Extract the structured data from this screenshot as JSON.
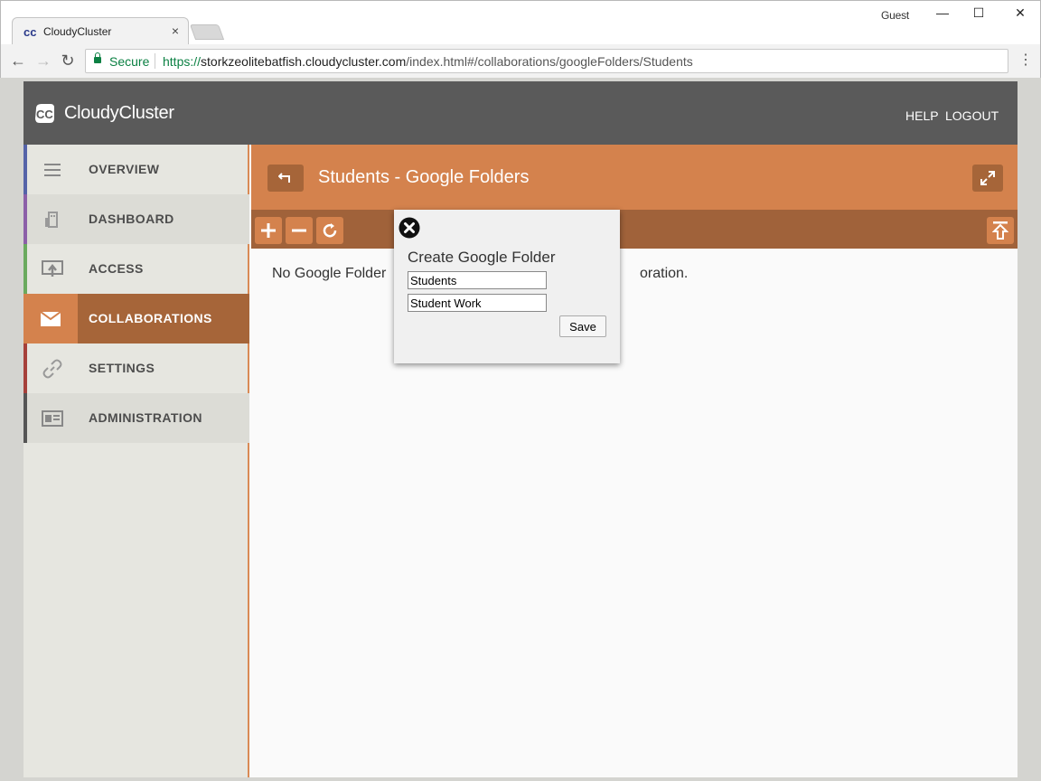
{
  "browser": {
    "tab_title": "CloudyCluster",
    "tab_close": "×",
    "profile": "Guest",
    "secure_label": "Secure",
    "url_scheme": "https://",
    "url_host": "storkzeolitebatfish.cloudycluster.com",
    "url_path": "/index.html#/collaborations/googleFolders/Students"
  },
  "app": {
    "brand": "CloudyCluster",
    "help": "HELP",
    "logout": "LOGOUT"
  },
  "sidebar": {
    "items": [
      {
        "label": "OVERVIEW",
        "icon": "menu-icon",
        "stripe": "#5563a8"
      },
      {
        "label": "DASHBOARD",
        "icon": "dashboard-icon",
        "stripe": "#8c5fa8"
      },
      {
        "label": "ACCESS",
        "icon": "access-icon",
        "stripe": "#6aaa5e"
      },
      {
        "label": "COLLABORATIONS",
        "icon": "envelope-icon",
        "stripe": "#d4824d"
      },
      {
        "label": "SETTINGS",
        "icon": "link-icon",
        "stripe": "#a6403a"
      },
      {
        "label": "ADMINISTRATION",
        "icon": "id-card-icon",
        "stripe": "#555555"
      }
    ]
  },
  "content": {
    "title": "Students - Google Folders",
    "empty_left": "No Google Folder",
    "empty_right": "oration."
  },
  "dialog": {
    "title": "Create Google Folder",
    "field1_value": "Students",
    "field2_value": "Student Work",
    "save_label": "Save"
  },
  "colors": {
    "accent": "#d4824d",
    "accent_dark": "#a66539",
    "header": "#5a5a5a"
  }
}
